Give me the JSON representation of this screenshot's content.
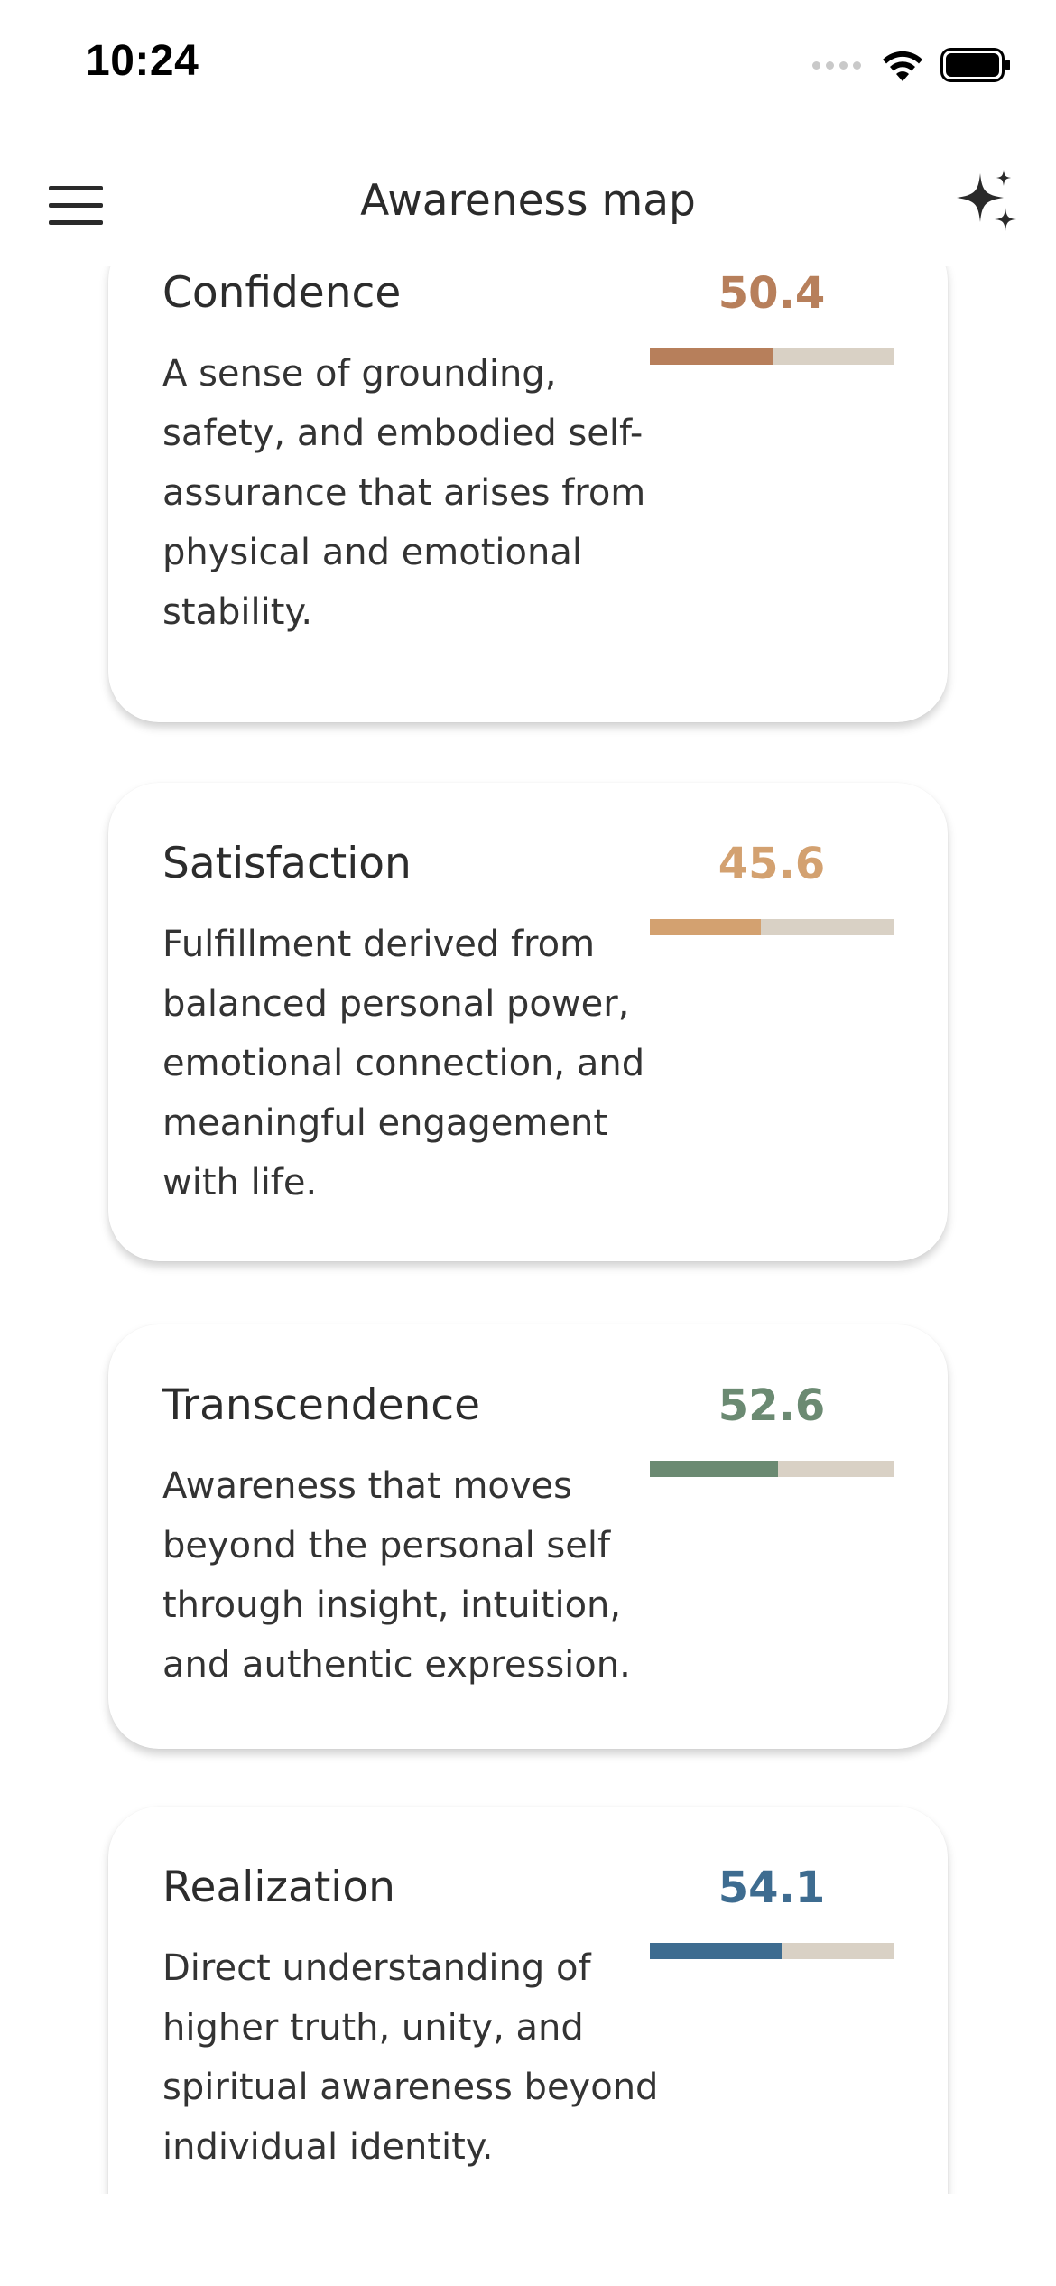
{
  "status": {
    "time": "10:24"
  },
  "header": {
    "title": "Awareness map"
  },
  "cards": [
    {
      "title": "Confidence",
      "score": "50.4",
      "progress": 0.504,
      "color": "#b77f5b",
      "description": "A sense of grounding, safety, and embodied self-assurance that arises from physical and emotional stability."
    },
    {
      "title": "Satisfaction",
      "score": "45.6",
      "progress": 0.456,
      "color": "#d3a170",
      "description": "Fulfillment derived from balanced personal power, emotional connection, and meaningful engagement with life."
    },
    {
      "title": "Transcendence",
      "score": "52.6",
      "progress": 0.526,
      "color": "#6b8a72",
      "description": "Awareness that moves beyond the personal self through insight, intuition, and authentic expression."
    },
    {
      "title": "Realization",
      "score": "54.1",
      "progress": 0.541,
      "color": "#3e6c90",
      "description": "Direct understanding of higher truth, unity, and spiritual awareness beyond individual identity."
    }
  ]
}
